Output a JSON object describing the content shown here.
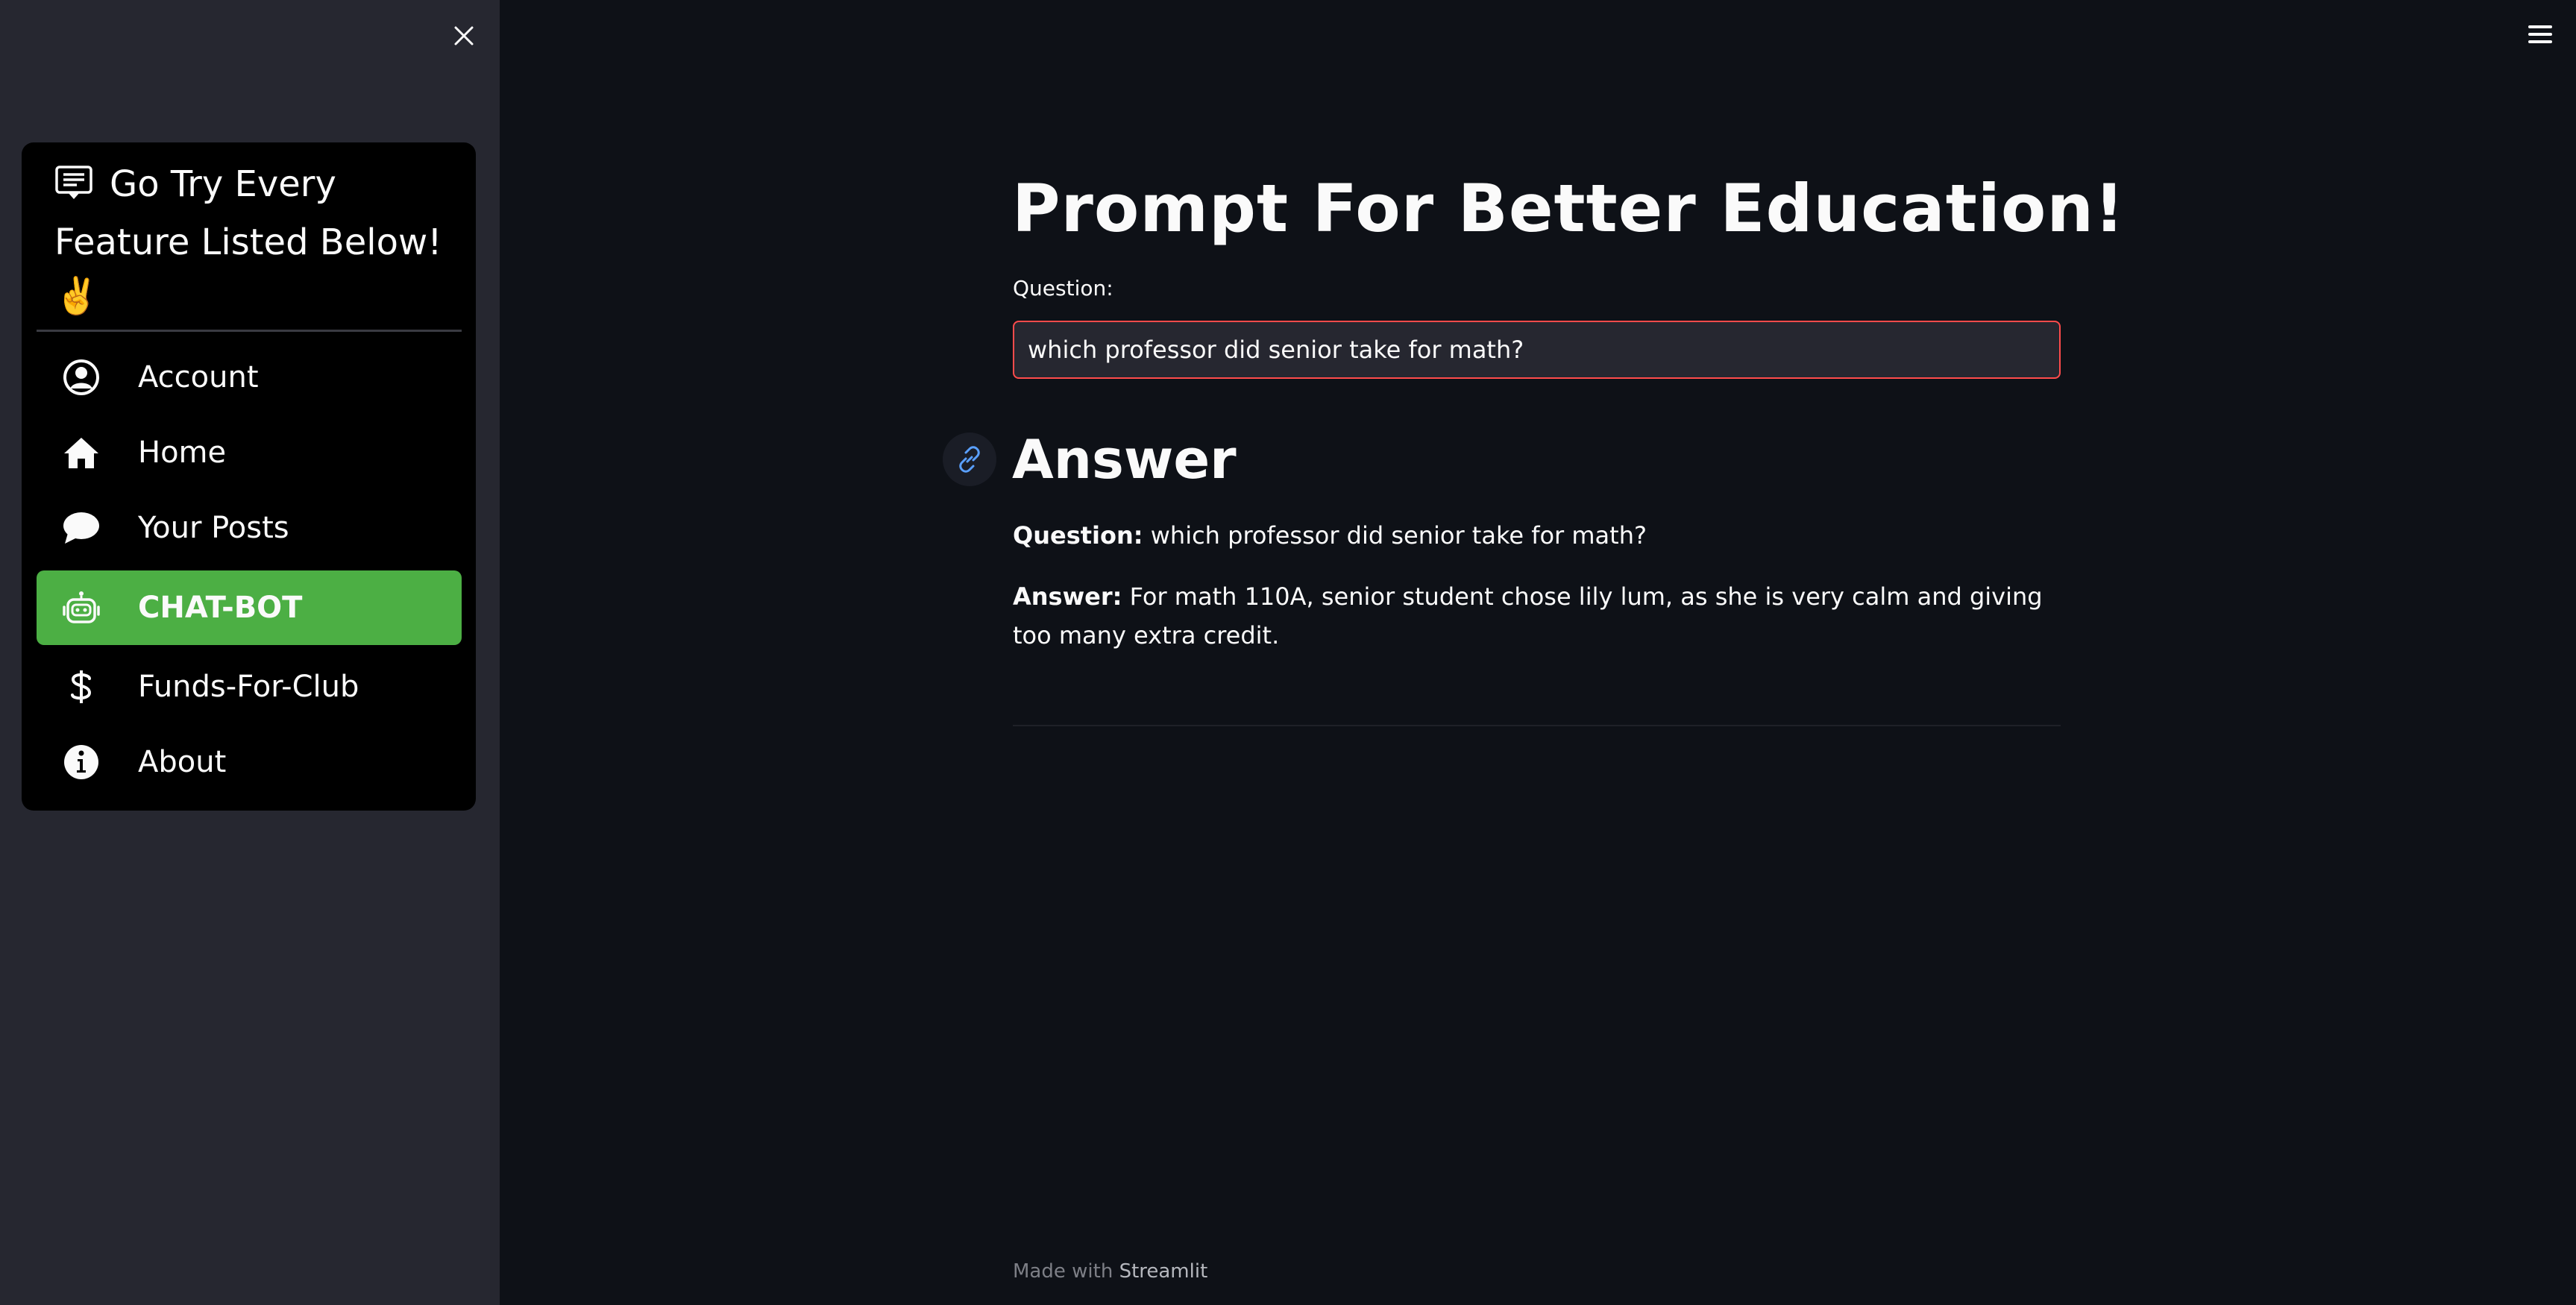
{
  "sidebar": {
    "menu_header": "Go Try Every Feature Listed Below! ✌️",
    "items": [
      {
        "label": "Account",
        "icon": "user-circle-icon"
      },
      {
        "label": "Home",
        "icon": "house-icon"
      },
      {
        "label": "Your Posts",
        "icon": "chat-bubble-icon"
      },
      {
        "label": "CHAT-BOT",
        "icon": "robot-icon",
        "active": true
      },
      {
        "label": "Funds-For-Club",
        "icon": "dollar-icon"
      },
      {
        "label": "About",
        "icon": "info-circle-icon"
      }
    ]
  },
  "main": {
    "title": "Prompt For Better Education!",
    "question_label": "Question:",
    "question_value": "which professor did senior take for math?",
    "answer_heading": "Answer",
    "qa": {
      "question_prefix": "Question:",
      "question_text": " which professor did senior take for math?",
      "answer_prefix": "Answer:",
      "answer_text": " For math 110A, senior student chose lily lum, as she is very calm and giving too many extra credit."
    }
  },
  "footer": {
    "made_with": "Made with ",
    "brand": "Streamlit"
  },
  "colors": {
    "active_item": "#4caf44",
    "input_border": "#ff4b4b",
    "main_bg": "#0e1117",
    "sidebar_bg": "#262730"
  }
}
